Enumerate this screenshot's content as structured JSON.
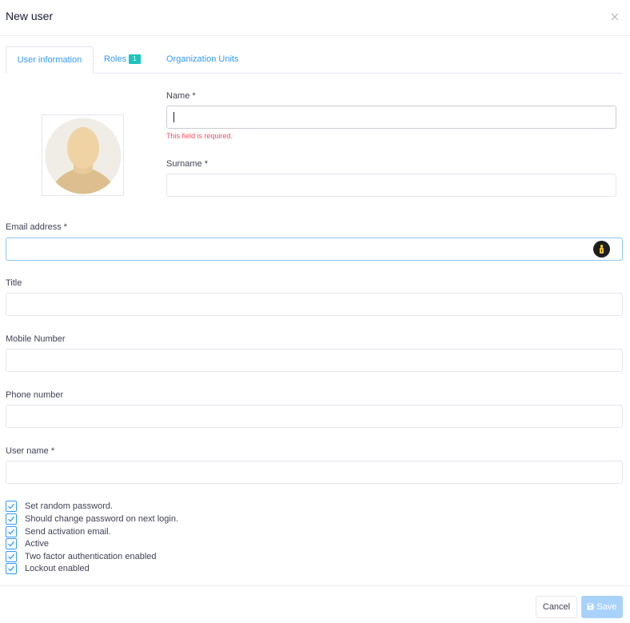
{
  "modal": {
    "title": "New user",
    "close_icon": "close-icon"
  },
  "tabs": [
    {
      "label": "User information",
      "active": true
    },
    {
      "label": "Roles",
      "badge": "1",
      "active": false
    },
    {
      "label": "Organization Units",
      "active": false
    }
  ],
  "avatar": {
    "icon": "default-avatar-icon"
  },
  "form": {
    "name": {
      "label": "Name *",
      "value": "",
      "error": "This field is required."
    },
    "surname": {
      "label": "Surname *",
      "value": ""
    },
    "email": {
      "label": "Email address *",
      "value": "",
      "icon": "password-manager-icon"
    },
    "title": {
      "label": "Title",
      "value": ""
    },
    "mobile": {
      "label": "Mobile Number",
      "value": ""
    },
    "phone": {
      "label": "Phone number",
      "value": ""
    },
    "username": {
      "label": "User name *",
      "value": ""
    }
  },
  "options": [
    {
      "label": "Set random password.",
      "checked": true
    },
    {
      "label": "Should change password on next login.",
      "checked": true
    },
    {
      "label": "Send activation email.",
      "checked": true
    },
    {
      "label": "Active",
      "checked": true
    },
    {
      "label": "Two factor authentication enabled",
      "checked": true
    },
    {
      "label": "Lockout enabled",
      "checked": true
    }
  ],
  "footer": {
    "cancel_label": "Cancel",
    "save_label": "Save"
  },
  "colors": {
    "accent": "#3699ff",
    "badge": "#1bc5bd",
    "error": "#f64e60",
    "save_disabled": "#a9d2fb"
  }
}
